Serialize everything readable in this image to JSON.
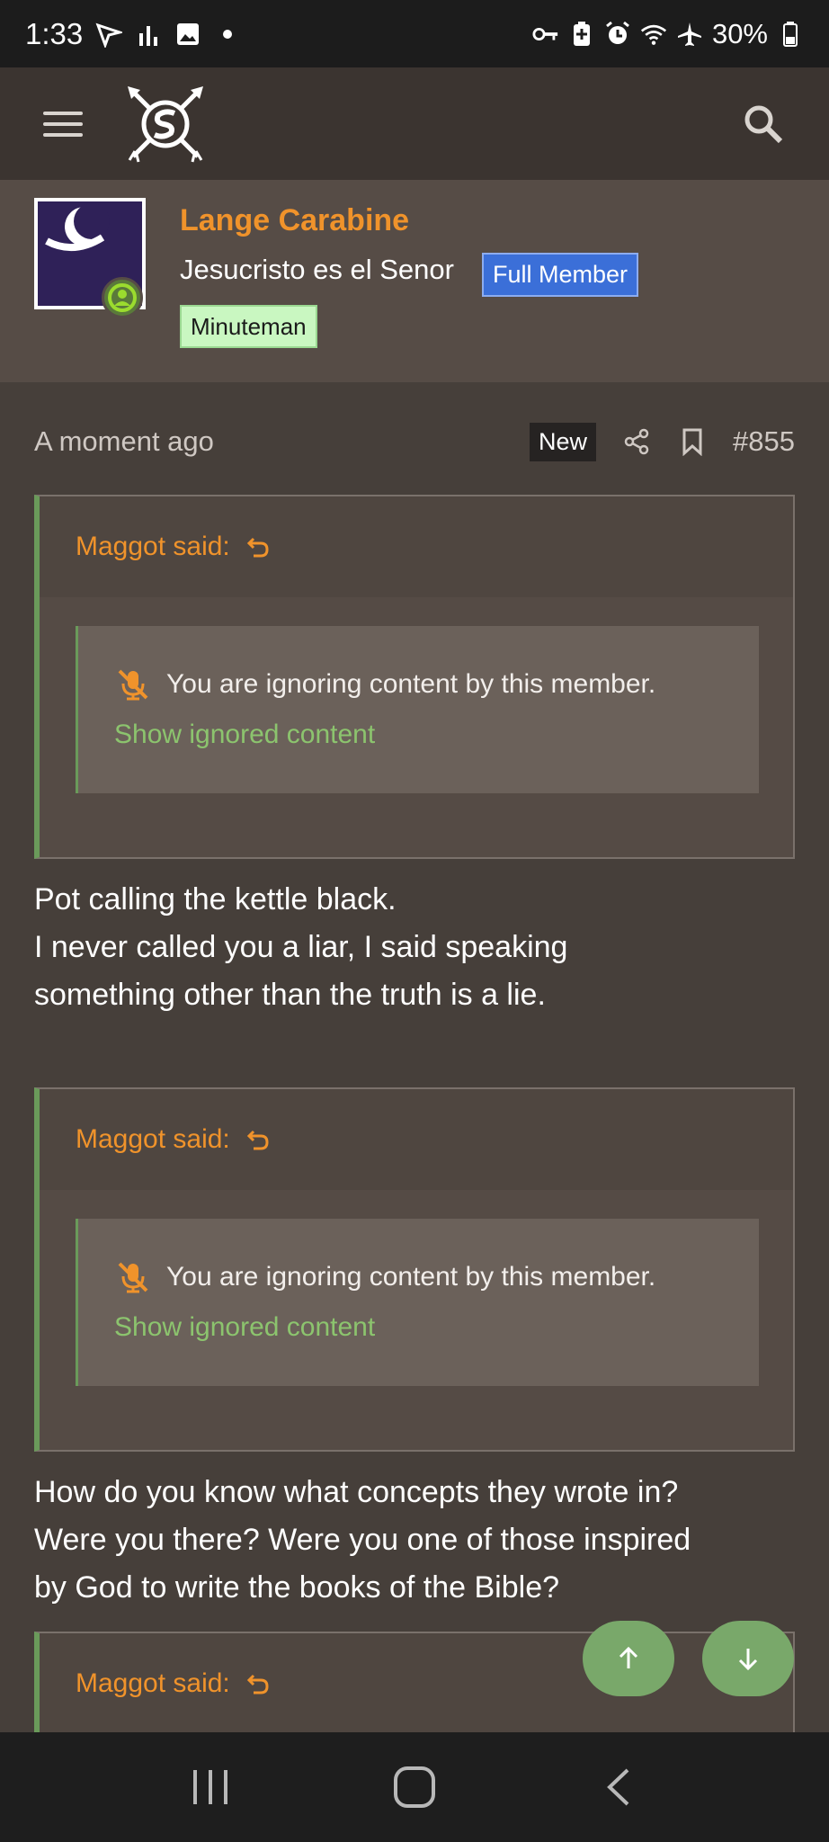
{
  "status_bar": {
    "time": "1:33",
    "battery": "30%",
    "icons_left": [
      "navigation-check-icon",
      "signal-bars-icon",
      "image-icon",
      "dot-icon"
    ],
    "icons_right": [
      "key-icon",
      "battery-saver-icon",
      "alarm-icon",
      "wifi-icon",
      "airplane-icon",
      "battery-icon"
    ]
  },
  "header": {
    "logo_icon": "crossed-arrows-logo-icon"
  },
  "user": {
    "name": "Lange Carabine",
    "title": "Jesucristo es el Senor",
    "badges": [
      "Full Member",
      "Minuteman"
    ]
  },
  "post": {
    "time": "A moment ago",
    "new_label": "New",
    "number": "#855",
    "quotes": [
      {
        "author_label": "Maggot said:",
        "ignored_text": "You are ignoring content by this member.",
        "show_label": "Show ignored content"
      },
      {
        "author_label": "Maggot said:",
        "ignored_text": "You are ignoring content by this member.",
        "show_label": "Show ignored content"
      },
      {
        "author_label": "Maggot said:"
      }
    ],
    "paragraphs": [
      [
        "Pot calling the kettle black.",
        "I never called you a liar, I said speaking",
        "something other than the truth is a lie."
      ],
      [
        "How do you know what concepts they wrote in?",
        "Were you there? Were you one of those inspired",
        "by God to write the books of the Bible?"
      ]
    ]
  },
  "colors": {
    "accent_orange": "#f0932b",
    "accent_green": "#6a9a5a",
    "link_green": "#8cc46e",
    "badge_blue": "#3b6fd8",
    "badge_mint": "#c9f7c1"
  }
}
